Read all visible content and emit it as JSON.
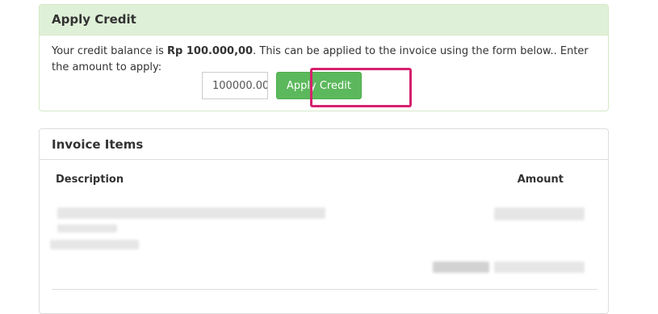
{
  "apply_credit": {
    "title": "Apply Credit",
    "text_before": "Your credit balance is ",
    "balance": "Rp 100.000,00",
    "text_after": ". This can be applied to the invoice using the form below.. Enter the amount to apply:",
    "amount_value": "100000.00",
    "button_label": "Apply Credit"
  },
  "invoice_items": {
    "title": "Invoice Items",
    "columns": {
      "description": "Description",
      "amount": "Amount"
    }
  },
  "colors": {
    "credit_heading_bg": "#dff0d8",
    "button_bg": "#5cb85c",
    "highlight": "#d6216e"
  }
}
